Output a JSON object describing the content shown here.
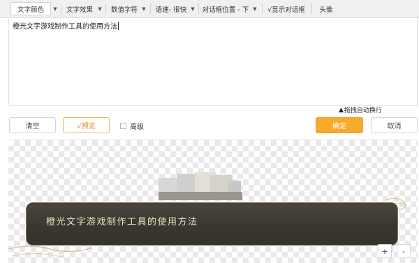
{
  "toolbar": {
    "text_color": "文字颜色",
    "text_effect": "文字效果",
    "value_chars": "数值字符",
    "speed": "语速- 很快",
    "dialog_position": "对话框位置 - 下",
    "show_dialog": "√显示对话框",
    "avatar": "头像"
  },
  "editor": {
    "content": "橙光文字游戏制作工具的使用方法"
  },
  "autowrap_label": "拖拽自动换行",
  "buttons": {
    "clear": "清空",
    "preview": "√预览",
    "advanced": "高级",
    "confirm": "确定",
    "cancel": "取消"
  },
  "preview": {
    "dialog_text": "橙光文字游戏制作工具的使用方法",
    "zoom_in": "+",
    "zoom_out": "-"
  },
  "colors": {
    "accent": "#f7ab2d",
    "dialog_bg": "#3a3731",
    "dialog_text": "#eee2c4"
  }
}
